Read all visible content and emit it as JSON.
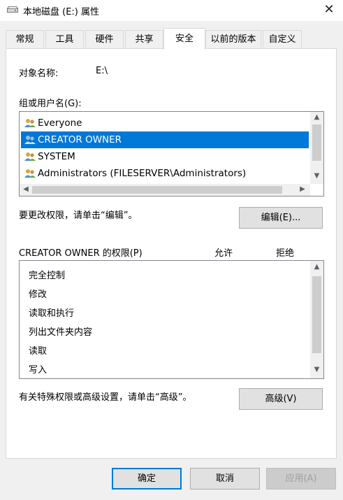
{
  "window": {
    "title": "本地磁盘 (E:) 属性",
    "close_glyph": "✕"
  },
  "tabs": [
    {
      "label": "常规"
    },
    {
      "label": "工具"
    },
    {
      "label": "硬件"
    },
    {
      "label": "共享"
    },
    {
      "label": "安全"
    },
    {
      "label": "以前的版本"
    },
    {
      "label": "自定义"
    }
  ],
  "active_tab": "安全",
  "object": {
    "label": "对象名称:",
    "value": "E:\\"
  },
  "groups": {
    "label": "组或用户名(G):",
    "items": [
      {
        "name": "Everyone"
      },
      {
        "name": "CREATOR OWNER"
      },
      {
        "name": "SYSTEM"
      },
      {
        "name": "Administrators (FILESERVER\\Administrators)"
      }
    ],
    "selected": "CREATOR OWNER"
  },
  "edit": {
    "hint": "要更改权限，请单击“编辑”。",
    "button": "编辑(E)..."
  },
  "permissions": {
    "label": "CREATOR OWNER 的权限(P)",
    "allow": "允许",
    "deny": "拒绝",
    "items": [
      "完全控制",
      "修改",
      "读取和执行",
      "列出文件夹内容",
      "读取",
      "写入"
    ]
  },
  "advanced": {
    "hint": "有关特殊权限或高级设置，请单击“高级”。",
    "button": "高级(V)"
  },
  "footer": {
    "ok": "确定",
    "cancel": "取消",
    "apply": "应用(A)"
  },
  "colors": {
    "selection": "#0078d7",
    "default_button_border": "#0078d7"
  }
}
